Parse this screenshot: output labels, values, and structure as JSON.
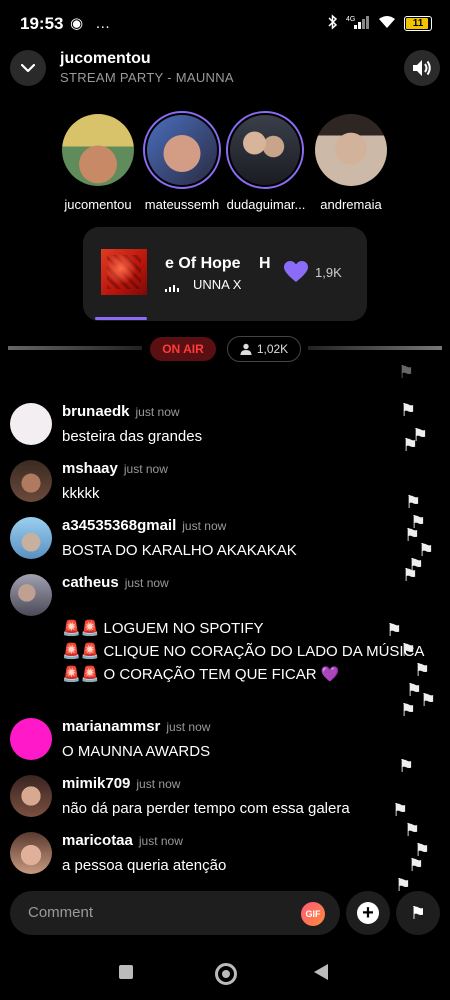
{
  "status_bar": {
    "time": "19:53",
    "left_icons": "◉ …",
    "network": "4G",
    "battery": "11"
  },
  "header": {
    "title": "jucomentou",
    "subtitle": "STREAM PARTY - MAUNNA"
  },
  "participants": [
    {
      "name": "jucomentou",
      "colors": [
        "#d7c27a",
        "#4a7a4a"
      ]
    },
    {
      "name": "mateussemh",
      "colors": [
        "#c89680",
        "#3a6ab0"
      ]
    },
    {
      "name": "dudaguimar...",
      "colors": [
        "#3a3a44",
        "#9a9ab0"
      ]
    },
    {
      "name": "andremaia",
      "colors": [
        "#c9b7a7",
        "#3a2a22"
      ]
    }
  ],
  "now_playing": {
    "title": "e Of Hope",
    "title_extra": "H",
    "artist": "UNNA X",
    "likes": "1,9K"
  },
  "live": {
    "on_air": "ON AIR",
    "listeners": "1,02K"
  },
  "messages": [
    {
      "user": "brunaedk",
      "time": "just now",
      "text": "besteira das grandes",
      "avatar": "#f3eef2"
    },
    {
      "user": "mshaay",
      "time": "just now",
      "text": "kkkkk",
      "avatar": "#6b4a3a"
    },
    {
      "user": "a34535368gmail",
      "time": "just now",
      "text": "BOSTA DO KARALHO AKAKAKAK",
      "avatar": "#7ab0d8"
    },
    {
      "user": "catheus",
      "time": "just now",
      "lines": [
        "🚨🚨 LOGUEM NO SPOTIFY",
        "🚨🚨 CLIQUE NO CORAÇÃO DO LADO DA MÚSICA",
        "🚨🚨 O CORAÇÃO TEM QUE FICAR 💜"
      ],
      "avatar": "#8a8a96"
    },
    {
      "user": "marianammsr",
      "time": "just now",
      "text": "O MAUNNA AWARDS",
      "avatar": "#ff19c8"
    },
    {
      "user": "mimik709",
      "time": "just now",
      "text": "não dá para perder tempo com essa galera",
      "avatar": "#b08070"
    },
    {
      "user": "maricotaa",
      "time": "just now",
      "text": "a pessoa queria atenção",
      "avatar": "#c89a80"
    }
  ],
  "composer": {
    "placeholder": "Comment",
    "gif": "GIF"
  },
  "colors": {
    "accent": "#8b6cf6",
    "on_air": "#ff3b3b",
    "background": "#000000"
  }
}
